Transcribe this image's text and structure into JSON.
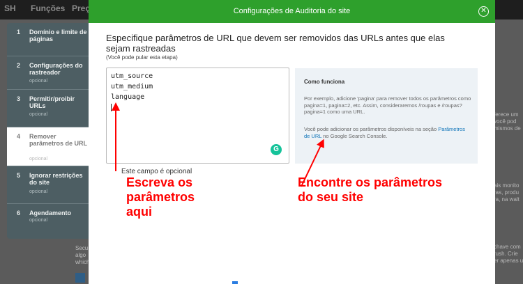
{
  "background": {
    "nav_partial_1": "SH",
    "nav_partial_2": "Funções",
    "nav_partial_3": "Preç",
    "right_text": [
      "ferece um",
      "você pod",
      "mismos de",
      "",
      "",
      "",
      "",
      "",
      "",
      "",
      "",
      "",
      "ais monito",
      "ras, produ",
      "ra, na walt",
      "",
      "",
      "",
      "chave com",
      "rush. Crie",
      "er apenas u"
    ],
    "bottom_text": [
      "Secu",
      "algo",
      "which"
    ]
  },
  "stepper": {
    "steps": [
      {
        "num": "1",
        "title": "Domínio e limite de páginas",
        "sub": ""
      },
      {
        "num": "2",
        "title": "Configurações do rastreador",
        "sub": "opcional"
      },
      {
        "num": "3",
        "title": "Permitir/proibir URLs",
        "sub": "opcional"
      },
      {
        "num": "4",
        "title": "Remover parâmetros de URL",
        "sub": "opcional"
      },
      {
        "num": "5",
        "title": "Ignorar restrições do site",
        "sub": "opcional"
      },
      {
        "num": "6",
        "title": "Agendamento",
        "sub": "opcional"
      }
    ]
  },
  "modal": {
    "title": "Configurações de Auditoria do site",
    "close_glyph": "✕",
    "heading": "Especifique parâmetros de URL que devem ser removidos das URLs antes que elas sejam rastreadas",
    "skip_note": "(Você pode pular esta etapa)",
    "textarea_lines": [
      "utm_source",
      "utm_medium",
      "language"
    ],
    "grammarly_glyph": "G",
    "optional_note": "Este campo é opcional",
    "info": {
      "title": "Como funciona",
      "p1": "Por exemplo, adicione 'pagina' para remover todos os parâmetros como pagina=1, pagina=2, etc. Assim, consideraremos /roupas e /roupas?pagina=1 como uma URL.",
      "p2_before": "Você pode adicionar os parâmetros disponíveis na seção ",
      "p2_link": "Parâmetros de URL",
      "p2_after": " no Google Search Console."
    }
  },
  "annotations": {
    "left": "Escreva os parâmetros aqui",
    "right": "Encontre os parâmetros do seu site",
    "color": "#ff0000"
  },
  "colors": {
    "header_green": "#2ea02c",
    "stepper_bg": "#4d5e63",
    "info_bg": "#edf2f6",
    "link_blue": "#0d73b8"
  }
}
